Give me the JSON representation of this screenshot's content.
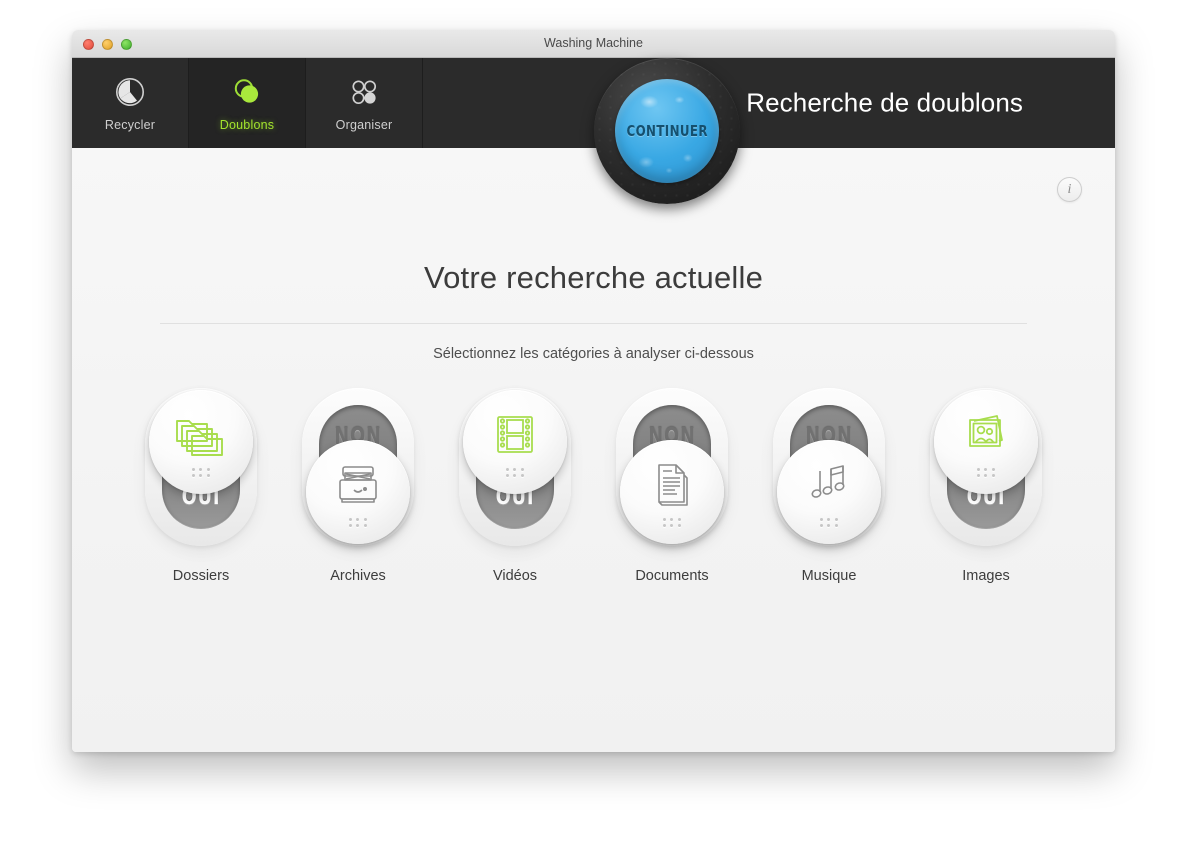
{
  "window": {
    "title": "Washing Machine",
    "traffic_lights": [
      "close",
      "minimize",
      "maximize"
    ]
  },
  "toolbar": {
    "items": [
      {
        "label": "Recycler",
        "icon": "clock-icon",
        "active": false
      },
      {
        "label": "Doublons",
        "icon": "duplicates-icon",
        "active": true
      },
      {
        "label": "Organiser",
        "icon": "organize-dots-icon",
        "active": false
      }
    ],
    "title": "Recherche de doublons",
    "continue_label": "CONTINUER",
    "accent_green": "#a3e32e",
    "continue_blue": "#39a8e4"
  },
  "content": {
    "info_label": "i",
    "headline": "Votre recherche actuelle",
    "subtitle": "Sélectionnez les catégories à analyser ci-dessous",
    "on_label": "OUI",
    "off_label": "NON"
  },
  "categories": [
    {
      "label": "Dossiers",
      "icon": "folders-icon",
      "state": "on",
      "state_label": "OUI"
    },
    {
      "label": "Archives",
      "icon": "archive-box-icon",
      "state": "off",
      "state_label": "NON"
    },
    {
      "label": "Vidéos",
      "icon": "film-strip-icon",
      "state": "on",
      "state_label": "OUI"
    },
    {
      "label": "Documents",
      "icon": "document-icon",
      "state": "off",
      "state_label": "NON"
    },
    {
      "label": "Musique",
      "icon": "music-notes-icon",
      "state": "off",
      "state_label": "NON"
    },
    {
      "label": "Images",
      "icon": "photo-people-icon",
      "state": "on",
      "state_label": "OUI"
    }
  ]
}
